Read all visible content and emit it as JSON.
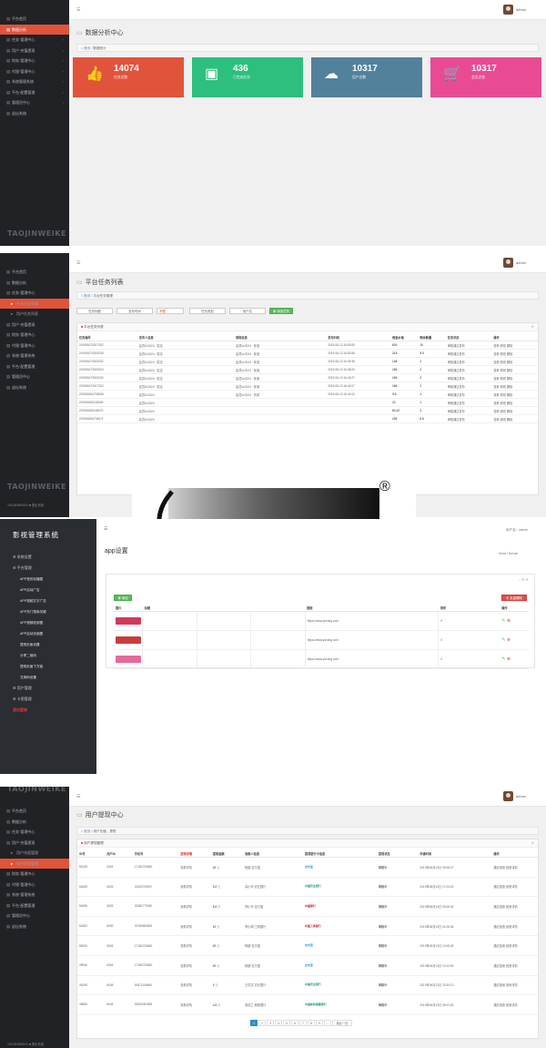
{
  "brand": "TAOJINWEIKE",
  "panel1": {
    "sidebar": [
      {
        "label": "平台首页",
        "active": false,
        "arrow": false
      },
      {
        "label": "数据分析",
        "active": true,
        "arrow": false
      },
      {
        "label": "任务·管理中心",
        "active": false,
        "arrow": true
      },
      {
        "label": "用户·充值提现",
        "active": false,
        "arrow": true
      },
      {
        "label": "财务·管理中心",
        "active": false,
        "arrow": true
      },
      {
        "label": "代理·管理中心",
        "active": false,
        "arrow": true
      },
      {
        "label": "系统管理系统",
        "active": false,
        "arrow": true
      },
      {
        "label": "平台·配置管理",
        "active": false,
        "arrow": true
      },
      {
        "label": "管理员中心",
        "active": false,
        "arrow": true
      },
      {
        "label": "退出系统",
        "active": false,
        "arrow": false
      }
    ],
    "username": "admin",
    "title": "数据分析中心",
    "crumb_home": "首页",
    "crumb_current": "数据统计",
    "stats": [
      {
        "value": "14074",
        "label": "任务总数",
        "color": "#e2533b",
        "icon": "thumbs-up-icon",
        "glyph": "👍"
      },
      {
        "value": "436",
        "label": "已完成任务",
        "color": "#2dbf7e",
        "icon": "cubes-icon",
        "glyph": "▣"
      },
      {
        "value": "10317",
        "label": "用户总数",
        "color": "#52819b",
        "icon": "cloud-download-icon",
        "glyph": "☁"
      },
      {
        "value": "10317",
        "label": "会员总数",
        "color": "#e94b93",
        "icon": "shopping-cart-icon",
        "glyph": "🛒"
      }
    ]
  },
  "panel2": {
    "sidebar": [
      {
        "label": "平台首页",
        "active": false,
        "sub": false
      },
      {
        "label": "数据分析",
        "active": false,
        "sub": false
      },
      {
        "label": "任务·管理中心",
        "active": false,
        "sub": false
      },
      {
        "label": "平台任务列表",
        "active": true,
        "sub": true
      },
      {
        "label": "用户任务列表",
        "active": false,
        "sub": true
      },
      {
        "label": "用户·充值提现",
        "active": false,
        "sub": false
      },
      {
        "label": "财务·管理中心",
        "active": false,
        "sub": false
      },
      {
        "label": "代理·管理中心",
        "active": false,
        "sub": false
      },
      {
        "label": "系统·管理系统",
        "active": false,
        "sub": false
      },
      {
        "label": "平台·配置管理",
        "active": false,
        "sub": false
      },
      {
        "label": "管理员中心",
        "active": false,
        "sub": false
      },
      {
        "label": "退出系统",
        "active": false,
        "sub": false
      }
    ],
    "footer": "TAOJINWEIKE ■ 退出系统",
    "username": "admin",
    "title": "平台任务列表",
    "crumb_home": "首页",
    "crumb_current": "平台任务管理",
    "filters": [
      "任务标题",
      "发布时间",
      "不限",
      "任务类型",
      "用户名"
    ],
    "add_label": "✚ 添加任务",
    "card_title": "平台任务列表",
    "columns": [
      "任务编号",
      "发布人信息",
      "领取信息",
      "发布时间",
      "佣金价格",
      "剩余数量",
      "任务状态",
      "操作"
    ],
    "rows": [
      [
        "201906170517332",
        "会员id:1524 · 姓名",
        "会员id:2024 · 张洛",
        "2019-06-13 16:53:55",
        "620",
        "10",
        "审核通过发布",
        "查看  修改  删除"
      ],
      [
        "201906170519335",
        "会员id:1524 · 姓名",
        "会员id:2024 · 张洛",
        "2019-06-13 16:52:56",
        "218",
        "5.5",
        "审核通过发布",
        "查看  修改  删除"
      ],
      [
        "201906170519332",
        "会员id:1524 · 姓名",
        "会员id:2024 · 张洛",
        "2019-06-13 16:49:38",
        "148",
        "2",
        "审核通过发布",
        "查看  修改  删除"
      ],
      [
        "201906170519333",
        "会员id:1524 · 姓名",
        "会员id:2024 · 张洛",
        "2019-06-13 16:48:00",
        "166",
        "2",
        "审核通过发布",
        "查看  修改  删除"
      ],
      [
        "201906170519332",
        "会员id:1524 · 姓名",
        "会员id:2024 · 张洛",
        "2019-06-13 16:42:27",
        "166",
        "2",
        "审核通过发布",
        "查看  修改  删除"
      ],
      [
        "201906170517332",
        "会员id:1524 · 姓名",
        "会员id:2024 · 张洛",
        "2019-06-13 16:42:07",
        "166",
        "2",
        "审核通过发布",
        "查看  修改  删除"
      ],
      [
        "201906204718068",
        "会员id:1524",
        "会员id:2024 · 完成",
        "2019-06-13 16:42:04",
        "5.6",
        "1",
        "审核通过发布",
        "查看  修改  删除"
      ],
      [
        "201906206118069",
        "会员id:1524",
        "",
        "",
        "10",
        "1",
        "审核通过发布",
        "查看  修改  删除"
      ],
      [
        "201906206118070",
        "会员id:1524",
        "",
        "",
        "63.22",
        "3",
        "审核通过发布",
        "查看  修改  删除"
      ],
      [
        "201906206718071",
        "会员id:1524",
        "",
        "",
        "208",
        "8.8",
        "审核通过发布",
        "查看  修改  删除"
      ]
    ]
  },
  "logo_mark": "®",
  "panel3": {
    "system_title": "影视管理系统",
    "sidebar": [
      {
        "label": "系统设置",
        "sub": false,
        "red": false
      },
      {
        "label": "平台管理",
        "sub": false,
        "red": false
      },
      {
        "label": "APP首页轮播图",
        "sub": true,
        "red": false
      },
      {
        "label": "APP启动广告",
        "sub": true,
        "red": false
      },
      {
        "label": "APP视频文字广告",
        "sub": true,
        "red": false
      },
      {
        "label": "APP热门搜索关键",
        "sub": true,
        "red": false
      },
      {
        "label": "APP视频底部图",
        "sub": true,
        "red": false
      },
      {
        "label": "APP启动页面图",
        "sub": true,
        "red": false
      },
      {
        "label": "提现页面设置",
        "sub": true,
        "red": false
      },
      {
        "label": "分享二维码",
        "sub": true,
        "red": false
      },
      {
        "label": "提现页面下方链",
        "sub": true,
        "red": false
      },
      {
        "label": "兑换码设置",
        "sub": true,
        "red": false
      },
      {
        "label": "用户管理",
        "sub": false,
        "red": false
      },
      {
        "label": "卡密管理",
        "sub": false,
        "red": false
      },
      {
        "label": "退出登录",
        "sub": false,
        "red": true
      }
    ],
    "user_label": "用户名：admin",
    "page_title": "app设置",
    "crumb": "Home / Banner",
    "add_label": "✚ 添加",
    "del_label": "⊗ 批量删除",
    "columns": [
      "图片",
      "标题",
      "",
      "",
      "链接",
      "排序",
      "操作"
    ],
    "rows": [
      {
        "color": "#d03a58",
        "url": "https://www.yuming.com",
        "sort": "0"
      },
      {
        "color": "#c93c3c",
        "url": "https://www.yuming.com",
        "sort": "0"
      },
      {
        "color": "#e46a9a",
        "url": "https://www.yuming.com",
        "sort": "0"
      }
    ]
  },
  "panel4": {
    "sidebar": [
      {
        "label": "平台首页",
        "active": false,
        "sub": false
      },
      {
        "label": "数据分析",
        "active": false,
        "sub": false
      },
      {
        "label": "任务·管理中心",
        "active": false,
        "sub": false
      },
      {
        "label": "用户·充值提现",
        "active": false,
        "sub": false
      },
      {
        "label": "用户充值管理",
        "active": false,
        "sub": true
      },
      {
        "label": "用户提现管理",
        "active": true,
        "sub": true
      },
      {
        "label": "财务·管理中心",
        "active": false,
        "sub": false
      },
      {
        "label": "代理·管理中心",
        "active": false,
        "sub": false
      },
      {
        "label": "系统·管理系统",
        "active": false,
        "sub": false
      },
      {
        "label": "平台·配置管理",
        "active": false,
        "sub": false
      },
      {
        "label": "管理员中心",
        "active": false,
        "sub": false
      },
      {
        "label": "退出系统",
        "active": false,
        "sub": false
      }
    ],
    "footer": "TAOJINWEIKE ■ 退出系统",
    "username": "admin",
    "title": "用户提现中心",
    "crumb_home": "首页",
    "crumb_current": "用户充值、提现",
    "card_title": "用户提现管理",
    "columns": [
      "ID号",
      "用户ID",
      "手机号",
      "提现详情",
      "提现金额",
      "收款人信息",
      "提现银行卡信息",
      "提现状态",
      "申请时间",
      "操作"
    ],
    "rows": [
      {
        "id": "55149",
        "uid": "6304",
        "phone": "17184730660",
        "detail": "查看详情",
        "amount": "20",
        "payee": "杨超 支付宝",
        "bank": "支付宝",
        "bank_color": "#1a8ce0",
        "status": "审核中",
        "time": "2019年06月13日 09:08:27"
      },
      {
        "id": "54455",
        "uid": "6025",
        "phone": "15302705057",
        "detail": "查看详情",
        "amount": "5.2",
        "payee": "高小玲 农业银行",
        "bank": "中国农业银行",
        "bank_color": "#2a9e6a",
        "status": "审核中",
        "time": "2019年06月13日 17:24:24"
      },
      {
        "id": "54456",
        "uid": "6326",
        "phone": "15381779360",
        "detail": "查看详情",
        "amount": "8.5",
        "payee": "郑小东 支付宝",
        "bank": "中国银行",
        "bank_color": "#c8282e",
        "status": "审核中",
        "time": "2019年06月13日 09:08:40"
      },
      {
        "id": "54452",
        "uid": "6052",
        "phone": "15150652663",
        "detail": "查看详情",
        "amount": "10",
        "payee": "李小明 工商银行",
        "bank": "中国工商银行",
        "bank_color": "#c8282e",
        "status": "审核中",
        "time": "2019年06月13日 21:26:36"
      },
      {
        "id": "55000",
        "uid": "6304",
        "phone": "17184730660",
        "detail": "查看详情",
        "amount": "20",
        "payee": "杨超 支付宝",
        "bank": "支付宝",
        "bank_color": "#1a8ce0",
        "status": "审核中",
        "time": "2019年06月13日 10:08:28"
      },
      {
        "id": "49946",
        "uid": "6304",
        "phone": "17184730660",
        "detail": "查看详情",
        "amount": "20",
        "payee": "杨超 支付宝",
        "bank": "支付宝",
        "bank_color": "#1a8ce0",
        "status": "审核中",
        "time": "2019年06月13日 10:10:53"
      },
      {
        "id": "46195",
        "uid": "6045",
        "phone": "16671154660",
        "detail": "查看详情",
        "amount": "3",
        "payee": "王洪志 农业银行",
        "bank": "中国农业银行",
        "bank_color": "#2a9e6a",
        "status": "审核中",
        "time": "2019年06月13日 23:30:13"
      },
      {
        "id": "45855",
        "uid": "6044",
        "phone": "15504051555",
        "detail": "查看详情",
        "amount": "4.5",
        "payee": "张桂兰 邮政银行",
        "bank": "中国邮政储蓄银行",
        "bank_color": "#2a9e6a",
        "status": "审核中",
        "time": "2019年06月13日 09:02:53"
      }
    ],
    "actions": "通过拒绝  拒绝详情",
    "unit": "元",
    "pager": [
      "1",
      "2",
      "3",
      "4",
      "5",
      "6",
      "7",
      "8",
      "9",
      "...",
      "最后一页"
    ]
  }
}
